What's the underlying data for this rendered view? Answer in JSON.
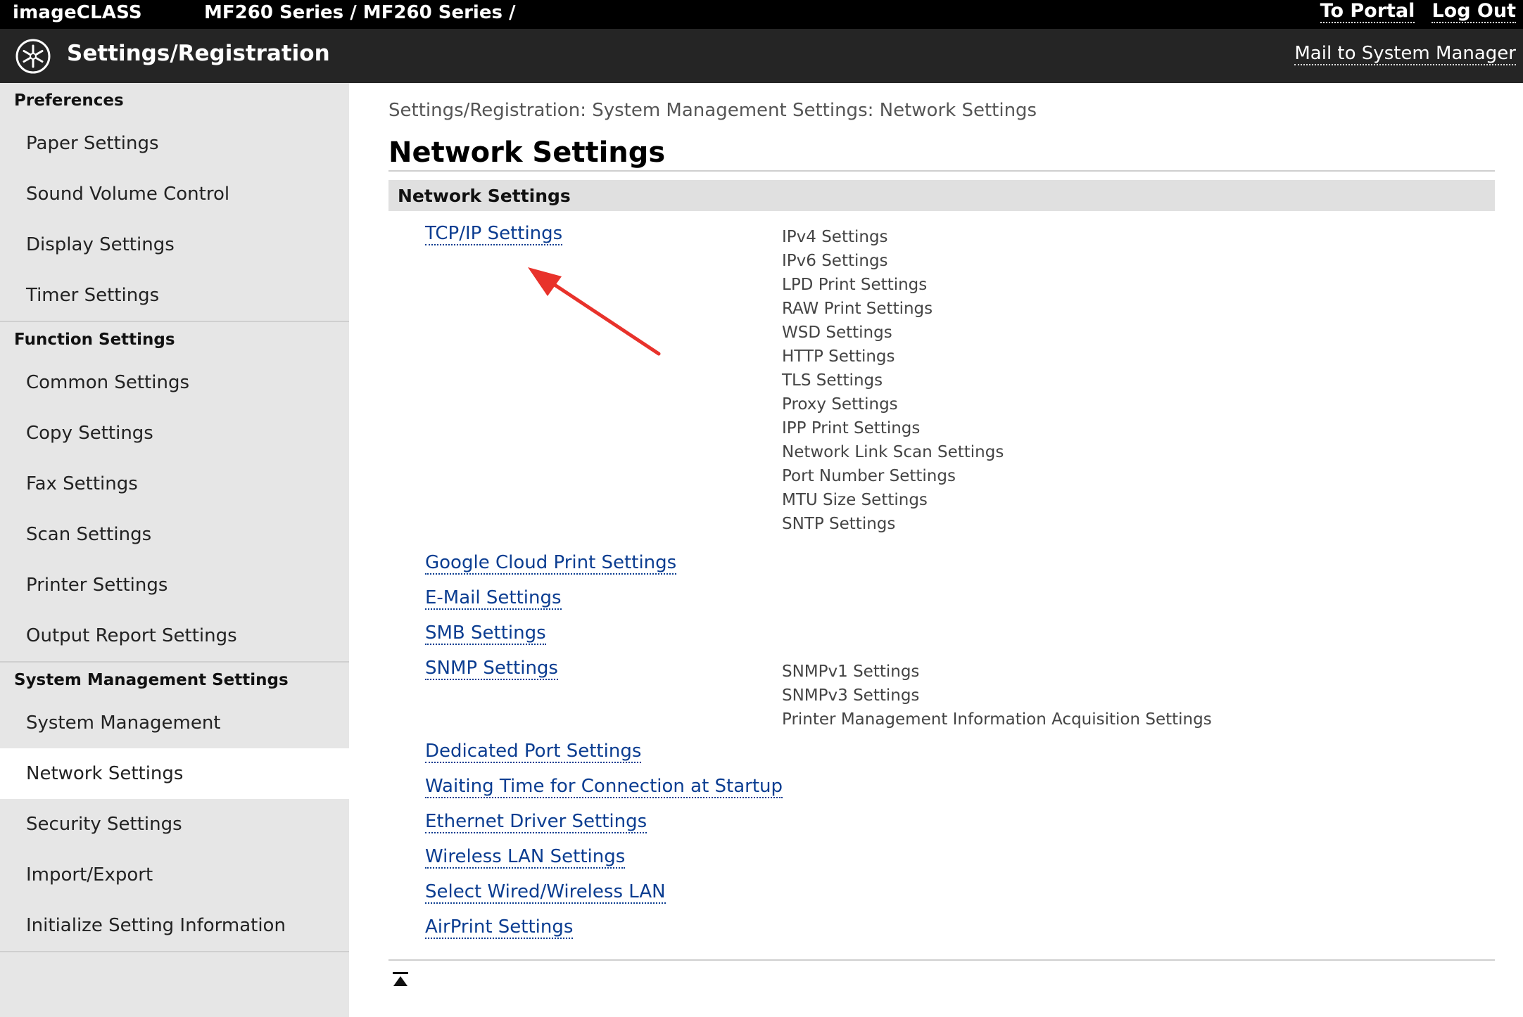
{
  "topbar": {
    "brand": "imageCLASS",
    "model_path": "MF260 Series / MF260 Series /",
    "portal_link": "To Portal",
    "logout_link": "Log Out"
  },
  "header": {
    "title": "Settings/Registration",
    "mail_link": "Mail to System Manager"
  },
  "sidebar": {
    "groups": [
      {
        "title": "Preferences",
        "items": [
          "Paper Settings",
          "Sound Volume Control",
          "Display Settings",
          "Timer Settings"
        ]
      },
      {
        "title": "Function Settings",
        "items": [
          "Common Settings",
          "Copy Settings",
          "Fax Settings",
          "Scan Settings",
          "Printer Settings",
          "Output Report Settings"
        ]
      },
      {
        "title": "System Management Settings",
        "items": [
          "System Management",
          "Network Settings",
          "Security Settings",
          "Import/Export",
          "Initialize Setting Information"
        ]
      }
    ],
    "active_item": "Network Settings"
  },
  "main": {
    "breadcrumb": "Settings/Registration: System Management Settings: Network Settings",
    "page_title": "Network Settings",
    "section_title": "Network Settings",
    "rows": [
      {
        "link": "TCP/IP Settings",
        "subs": [
          "IPv4 Settings",
          "IPv6 Settings",
          "LPD Print Settings",
          "RAW Print Settings",
          "WSD Settings",
          "HTTP Settings",
          "TLS Settings",
          "Proxy Settings",
          "IPP Print Settings",
          "Network Link Scan Settings",
          "Port Number Settings",
          "MTU Size Settings",
          "SNTP Settings"
        ]
      },
      {
        "link": "Google Cloud Print Settings",
        "subs": []
      },
      {
        "link": "E-Mail Settings",
        "subs": []
      },
      {
        "link": "SMB Settings",
        "subs": []
      },
      {
        "link": "SNMP Settings",
        "subs": [
          "SNMPv1 Settings",
          "SNMPv3 Settings",
          "Printer Management Information Acquisition Settings"
        ]
      },
      {
        "link": "Dedicated Port Settings",
        "subs": []
      },
      {
        "link": "Waiting Time for Connection at Startup",
        "subs": []
      },
      {
        "link": "Ethernet Driver Settings",
        "subs": []
      },
      {
        "link": "Wireless LAN Settings",
        "subs": []
      },
      {
        "link": "Select Wired/Wireless LAN",
        "subs": []
      },
      {
        "link": "AirPrint Settings",
        "subs": []
      }
    ]
  },
  "icons": {
    "logo": "settings-star-icon",
    "to_top": "back-to-top-icon",
    "annotation": "red-arrow-icon"
  },
  "colors": {
    "topbar": "#000000",
    "header": "#252525",
    "sidebar": "#e6e6e6",
    "link": "#0b3d91",
    "arrow": "#e8322b"
  }
}
